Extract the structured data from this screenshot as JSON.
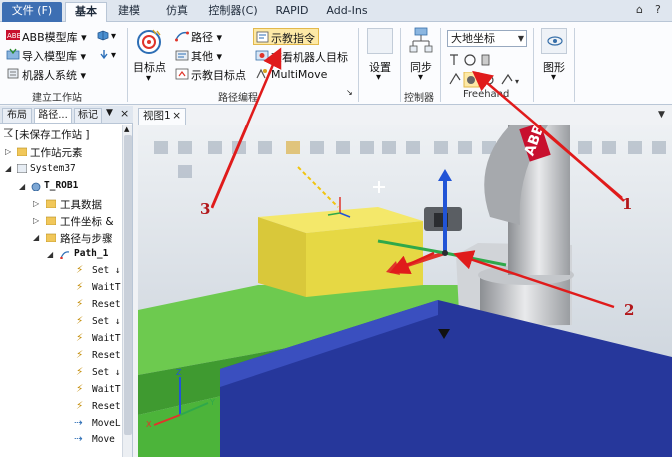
{
  "ribbon_tabs": [
    "文件 (F)",
    "基本",
    "建模",
    "仿真",
    "控制器(C)",
    "RAPID",
    "Add-Ins"
  ],
  "window_controls": [
    "⌂",
    "?"
  ],
  "build_station": {
    "abb_library": "ABB模型库",
    "import_library": "导入模型库",
    "robot_system": "机器人系统",
    "group_label": "建立工作站"
  },
  "path_programming": {
    "target_point": "目标点",
    "path": "路径",
    "other": "其他",
    "teach_target": "示教目标点",
    "teach_instruction": "示教指令",
    "view_robot_target": "查看机器人目标",
    "multimove": "MultiMove",
    "group_label": "路径编程"
  },
  "settings": {
    "label": "设置"
  },
  "controller": {
    "sync": "同步",
    "group_label": "控制器"
  },
  "freehand": {
    "frame_select": "大地坐标",
    "group_label": "Freehand"
  },
  "graphics": {
    "label": "图形"
  },
  "left_panel": {
    "tabs": [
      "布局",
      "路径...",
      "标记"
    ],
    "station": "[未保存工作站 ]",
    "station_elements": "工作站元素",
    "system": "System37",
    "task": "T_ROB1",
    "tool_data": "工具数据",
    "work_object": "工件坐标 &",
    "paths_steps": "路径与步骤",
    "path_name": "Path_1",
    "instructions": [
      "Set ↓",
      "WaitT",
      "Reset",
      "Set ↓",
      "WaitT",
      "Reset",
      "Set ↓",
      "WaitT",
      "Reset",
      "MoveL",
      "Move"
    ]
  },
  "view": {
    "tab_label": "视图1",
    "close": "×"
  },
  "annotations": [
    "1",
    "2",
    "3"
  ],
  "colors": {
    "ribbon_blue": "#3d6fb3",
    "highlight": "#fde9a6",
    "yellow_part": "#e6d844",
    "green_conveyor": "#4cb43a",
    "blue_table": "#26379b",
    "arrow_red": "#e01b1b"
  }
}
